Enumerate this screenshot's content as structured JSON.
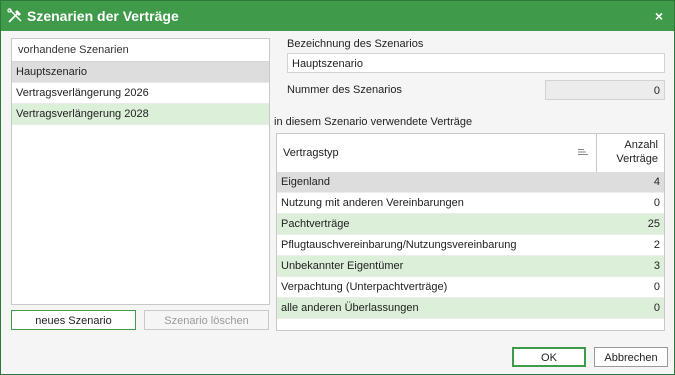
{
  "window": {
    "title": "Szenarien der Verträge",
    "close_label": "×"
  },
  "left_panel": {
    "header": "vorhandene Szenarien",
    "items": [
      {
        "label": "Hauptszenario",
        "state": "selected"
      },
      {
        "label": "Vertragsverlängerung 2026",
        "state": "normal"
      },
      {
        "label": "Vertragsverlängerung 2028",
        "state": "highlighted"
      }
    ],
    "new_button": "neues Szenario",
    "delete_button": "Szenario löschen"
  },
  "details": {
    "name_label": "Bezeichnung des Szenarios",
    "name_value": "Hauptszenario",
    "number_label": "Nummer des Szenarios",
    "number_value": "0",
    "contracts_label": "in diesem Szenario verwendete Verträge"
  },
  "grid": {
    "col_type": "Vertragstyp",
    "col_count_line1": "Anzahl",
    "col_count_line2": "Verträge",
    "rows": [
      {
        "type": "Eigenland",
        "count": "4"
      },
      {
        "type": "Nutzung mit anderen Vereinbarungen",
        "count": "0"
      },
      {
        "type": "Pachtverträge",
        "count": "25"
      },
      {
        "type": "Pflugtauschvereinbarung/Nutzungsvereinbarung",
        "count": "2"
      },
      {
        "type": "Unbekannter Eigentümer",
        "count": "3"
      },
      {
        "type": "Verpachtung (Unterpachtverträge)",
        "count": "0"
      },
      {
        "type": "alle anderen Überlassungen",
        "count": "0"
      }
    ]
  },
  "footer": {
    "ok": "OK",
    "cancel": "Abbrechen"
  },
  "colors": {
    "accent": "#3f9a49",
    "row_green": "#dcefd9",
    "row_grey": "#dddddd"
  }
}
